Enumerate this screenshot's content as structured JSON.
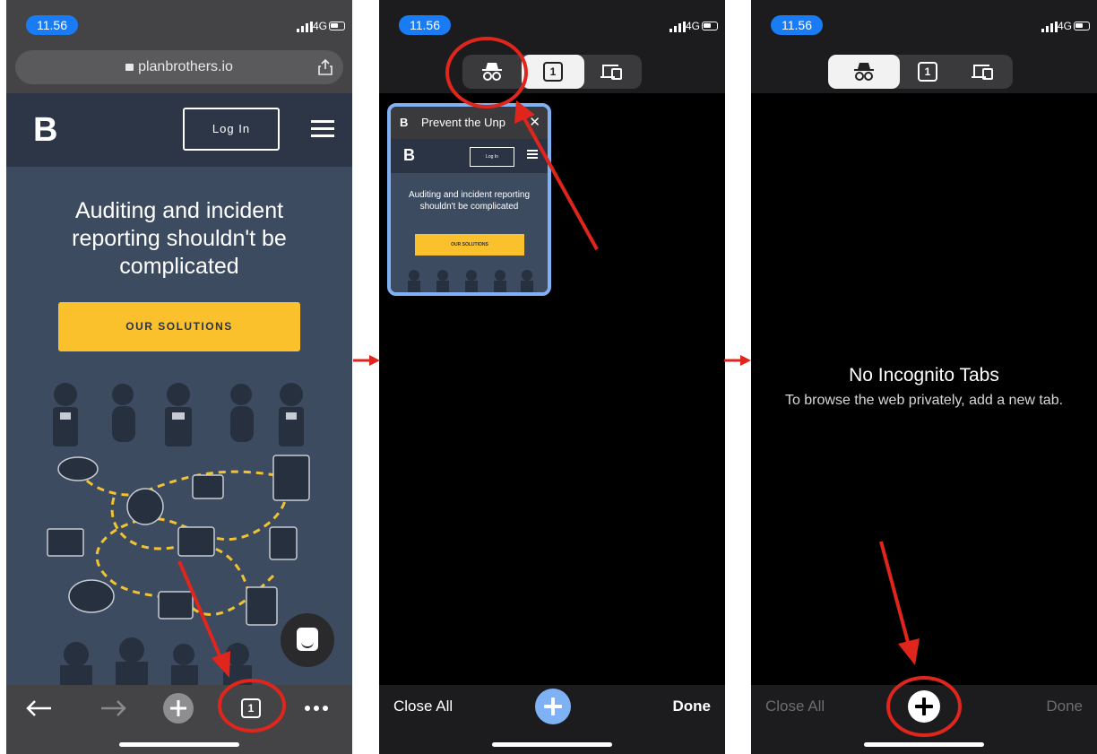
{
  "status": {
    "time": "11.56",
    "network": "4G"
  },
  "screen1": {
    "url": "planbrothers.io",
    "logo": "B",
    "login_label": "Log In",
    "hero_title": "Auditing and incident reporting shouldn't be complicated",
    "cta_label": "OUR SOLUTIONS",
    "tab_count": "1"
  },
  "screen2": {
    "tab_count": "1",
    "card_title": "Prevent the Unp",
    "card_logo": "B",
    "card_login": "Log In",
    "card_hero": "Auditing and incident reporting shouldn't be complicated",
    "card_cta": "OUR SOLUTIONS",
    "close_all": "Close All",
    "done": "Done"
  },
  "screen3": {
    "tab_count": "1",
    "empty_title": "No Incognito Tabs",
    "empty_sub": "To browse the web privately, add a new tab.",
    "close_all": "Close All",
    "done": "Done"
  },
  "colors": {
    "accent_blue": "#1a7cf5",
    "cta_yellow": "#fbc12d",
    "annotation_red": "#e0261c",
    "selected_blue": "#7fb2f5"
  }
}
